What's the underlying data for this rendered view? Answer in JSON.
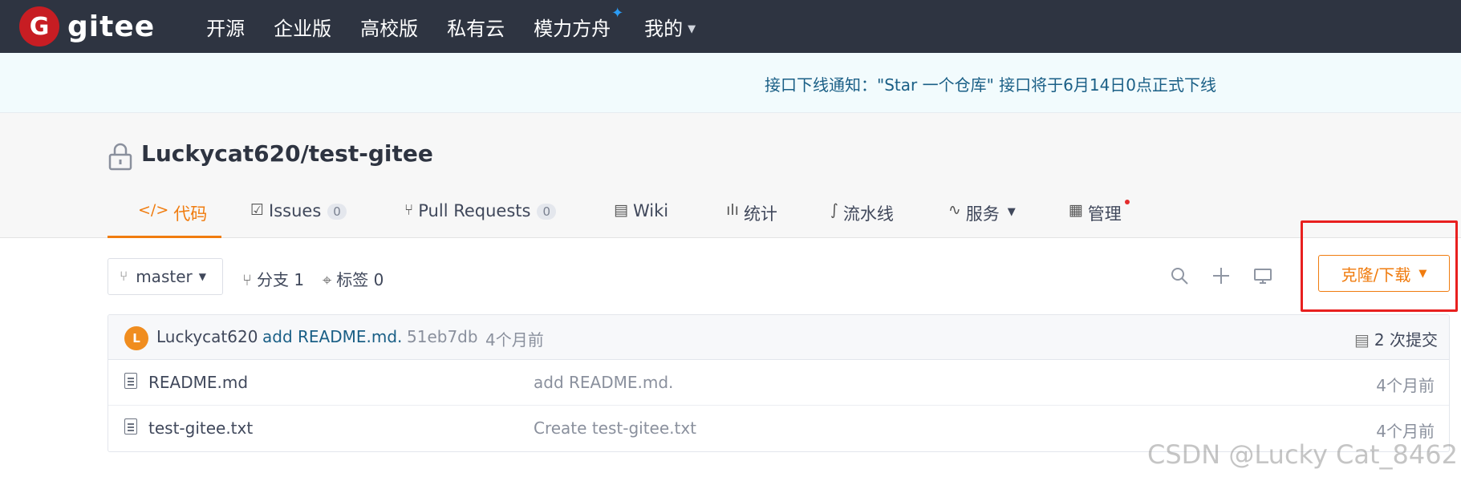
{
  "brand": {
    "logo_letter": "G",
    "name": "gitee"
  },
  "topnav": {
    "items": [
      {
        "label": "开源"
      },
      {
        "label": "企业版"
      },
      {
        "label": "高校版"
      },
      {
        "label": "私有云"
      },
      {
        "label": "模力方舟"
      },
      {
        "label": "我的"
      }
    ]
  },
  "notice": {
    "text": "接口下线通知：\"Star 一个仓库\" 接口将于6月14日0点正式下线"
  },
  "project": {
    "title": "Luckycat620/test-gitee",
    "tabs": [
      {
        "label": "代码"
      },
      {
        "label": "Issues",
        "count": "0"
      },
      {
        "label": "Pull Requests",
        "count": "0"
      },
      {
        "label": "Wiki"
      },
      {
        "label": "统计"
      },
      {
        "label": "流水线"
      },
      {
        "label": "服务"
      },
      {
        "label": "管理"
      }
    ]
  },
  "toolbar": {
    "branch": "master",
    "branches": "分支 1",
    "tags": "标签 0",
    "clone_label": "克隆/下载"
  },
  "commit": {
    "avatar_letter": "L",
    "author": "Luckycat620",
    "message": "add README.md.",
    "hash": "51eb7db",
    "time": "4个月前",
    "count_label": "2 次提交"
  },
  "files": [
    {
      "name": "README.md",
      "message": "add README.md.",
      "time": "4个月前"
    },
    {
      "name": "test-gitee.txt",
      "message": "Create test-gitee.txt",
      "time": "4个月前"
    }
  ],
  "watermark": "CSDN @Lucky Cat_8462",
  "colors": {
    "accent": "#f07c0f",
    "nav_bg": "#2e3441",
    "brand_red": "#c71d23",
    "highlight": "#e8201f"
  }
}
